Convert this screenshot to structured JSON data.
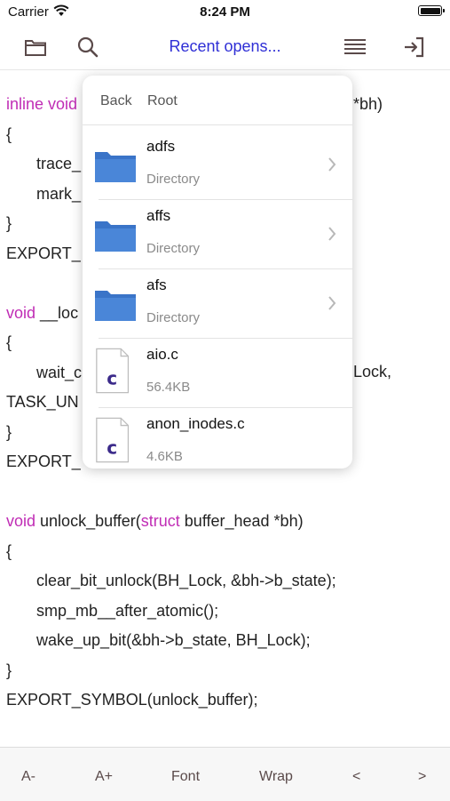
{
  "status_bar": {
    "carrier": "Carrier",
    "time": "8:24 PM"
  },
  "nav": {
    "title": "Recent opens...",
    "left_icons": [
      "folder-icon",
      "search-icon"
    ],
    "right_icons": [
      "list-icon",
      "exit-icon"
    ],
    "accent_color": "#2f2fd6"
  },
  "code_lines": [
    "inline void",
    "{",
    "trace_",
    "mark_",
    "}",
    "EXPORT_",
    "",
    "void __loc",
    "{",
    "wait_c",
    "TASK_UN",
    "}",
    "EXPORT_",
    "",
    "void unlock_buffer(struct buffer_head *bh)",
    "{",
    "clear_bit_unlock(BH_Lock, &bh->b_state);",
    "smp_mb__after_atomic();",
    "wake_up_bit(&bh->b_state, BH_Lock);",
    "}",
    "EXPORT_SYMBOL(unlock_buffer);"
  ],
  "code_fragments": {
    "line1_tail": "*bh)",
    "line10_tail": "Lock,"
  },
  "code": {
    "l1_kw": "inline void",
    "l8_kw": "void",
    "l8_rest": " __loc",
    "l15_kw1": "void",
    "l15_mid": " unlock_buffer(",
    "l15_kw2": "struct",
    "l15_rest": " buffer_head *bh)",
    "keyword_color": "#c02db5"
  },
  "popover": {
    "back_label": "Back",
    "path_label": "Root",
    "items": [
      {
        "name": "adfs",
        "meta": "Directory",
        "kind": "folder"
      },
      {
        "name": "affs",
        "meta": "Directory",
        "kind": "folder"
      },
      {
        "name": "afs",
        "meta": "Directory",
        "kind": "folder"
      },
      {
        "name": "aio.c",
        "meta": "56.4KB",
        "kind": "c-file"
      },
      {
        "name": "anon_inodes.c",
        "meta": "4.6KB",
        "kind": "c-file"
      }
    ],
    "folder_color": "#4a86d8"
  },
  "toolbar": {
    "font_smaller": "A-",
    "font_larger": "A+",
    "font": "Font",
    "wrap": "Wrap",
    "prev": "<",
    "next": ">"
  }
}
